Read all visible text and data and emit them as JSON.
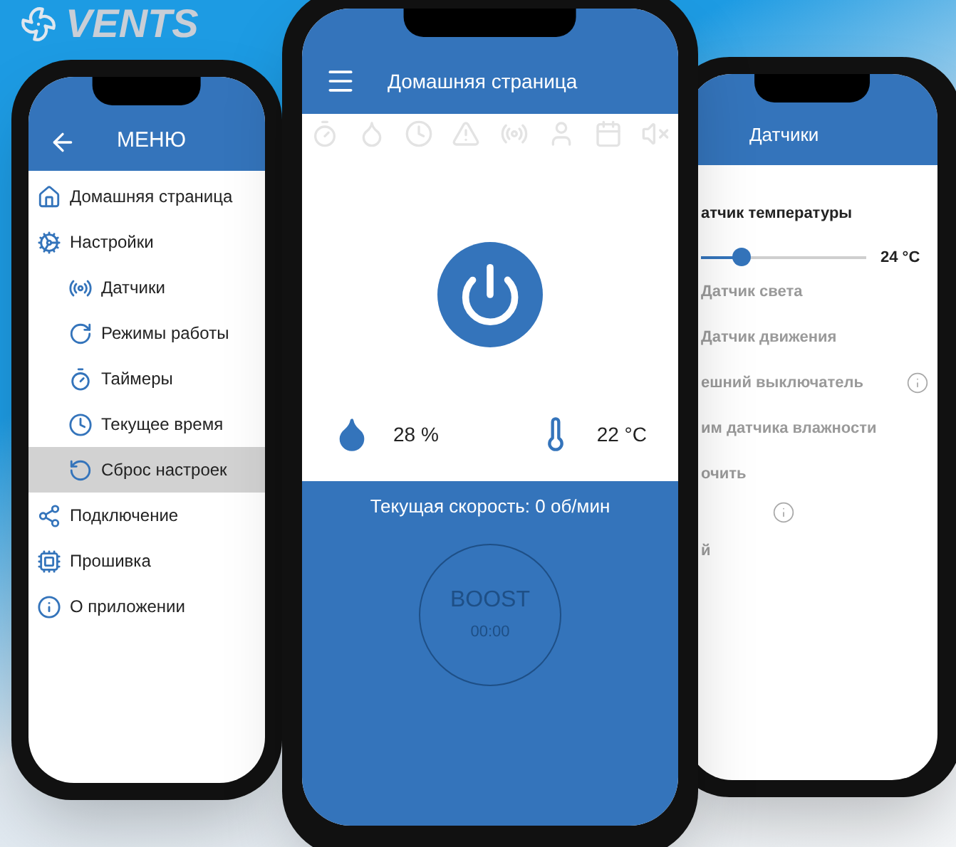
{
  "logo": {
    "text": "VENTS"
  },
  "menu_screen": {
    "title": "МЕНЮ",
    "items": [
      {
        "label": "Домашняя страница",
        "selected": false
      },
      {
        "label": "Настройки",
        "selected": false,
        "children": [
          {
            "label": "Датчики",
            "selected": false
          },
          {
            "label": "Режимы работы",
            "selected": false
          },
          {
            "label": "Таймеры",
            "selected": false
          },
          {
            "label": "Текущее время",
            "selected": false
          },
          {
            "label": "Сброс настроек",
            "selected": true
          }
        ]
      },
      {
        "label": "Подключение",
        "selected": false
      },
      {
        "label": "Прошивка",
        "selected": false
      },
      {
        "label": "О приложении",
        "selected": false
      }
    ]
  },
  "home_screen": {
    "title": "Домашняя страница",
    "humidity": "28 %",
    "temperature": "22 °C",
    "power_on": true,
    "speed": "Текущая скорость: 0 об/мин",
    "boost": {
      "label": "BOOST",
      "time": "00:00",
      "active": false
    }
  },
  "sensors_screen": {
    "title": "Датчики",
    "temperature_sensor": {
      "label": "атчик температуры",
      "level": 0.24,
      "reading": "24 °C"
    },
    "items": [
      {
        "kind": "text",
        "label": "Датчик света",
        "disabled": true,
        "info": false
      },
      {
        "kind": "text",
        "label": "Датчик движения",
        "disabled": true,
        "info": false
      },
      {
        "kind": "text",
        "label": "ешний выключатель",
        "disabled": true,
        "info": true
      },
      {
        "kind": "text",
        "label": "им датчика влажности",
        "disabled": true,
        "info": false
      },
      {
        "kind": "text",
        "label": "очить",
        "disabled": true,
        "info": false
      },
      {
        "kind": "info",
        "disabled": true
      },
      {
        "kind": "text",
        "label": "й",
        "disabled": true,
        "info": false
      }
    ]
  }
}
